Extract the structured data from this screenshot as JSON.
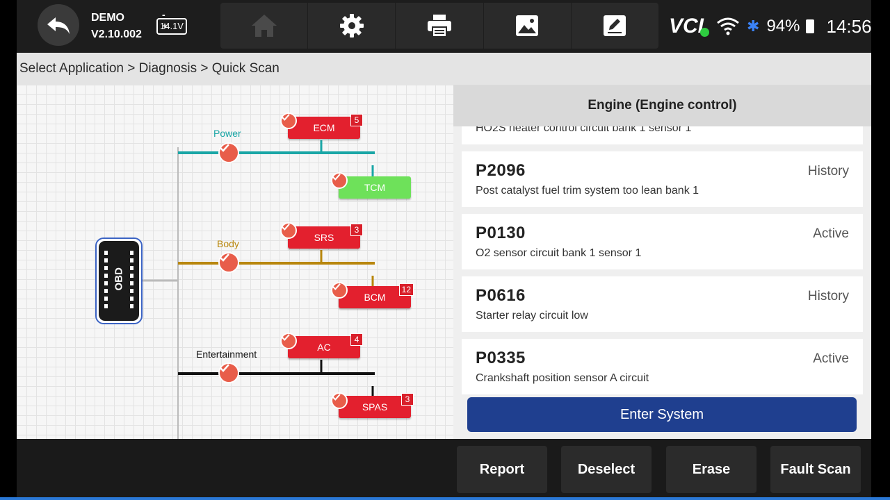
{
  "header": {
    "mode": "DEMO",
    "version": "V2.10.002",
    "voltage": "14.1V",
    "tools": [
      "home-icon",
      "gear-icon",
      "printer-icon",
      "image-icon",
      "edit-icon"
    ]
  },
  "status": {
    "vci_label": "VCI",
    "battery_pct": "94%",
    "time": "14:56",
    "colors": {
      "vci_dot": "#2ecc40",
      "bluetooth": "#3b82f6"
    }
  },
  "breadcrumb": "Select Application > Diagnosis > Quick Scan",
  "diagram": {
    "obd_label": "OBD",
    "buses": [
      {
        "name": "Power",
        "color": "#1aa6a6"
      },
      {
        "name": "Body",
        "color": "#b8860b"
      },
      {
        "name": "Entertainment",
        "color": "#000000"
      }
    ],
    "modules": [
      {
        "name": "ECM",
        "count": "5",
        "color": "red"
      },
      {
        "name": "TCM",
        "count": "",
        "color": "green"
      },
      {
        "name": "SRS",
        "count": "3",
        "color": "red"
      },
      {
        "name": "BCM",
        "count": "12",
        "color": "red"
      },
      {
        "name": "AC",
        "count": "4",
        "color": "red"
      },
      {
        "name": "SPAS",
        "count": "3",
        "color": "red"
      }
    ]
  },
  "panel": {
    "title": "Engine (Engine control)",
    "partial_desc": "HO2S heater control circuit bank 1 sensor 1",
    "dtcs": [
      {
        "code": "P2096",
        "status": "History",
        "desc": "Post catalyst fuel trim system too lean bank 1"
      },
      {
        "code": "P0130",
        "status": "Active",
        "desc": "O2 sensor circuit bank 1 sensor 1"
      },
      {
        "code": "P0616",
        "status": "History",
        "desc": "Starter relay circuit low"
      },
      {
        "code": "P0335",
        "status": "Active",
        "desc": "Crankshaft position sensor A circuit"
      }
    ],
    "enter_label": "Enter System"
  },
  "footer": {
    "buttons": [
      "Report",
      "Deselect",
      "Erase",
      "Fault Scan"
    ]
  }
}
